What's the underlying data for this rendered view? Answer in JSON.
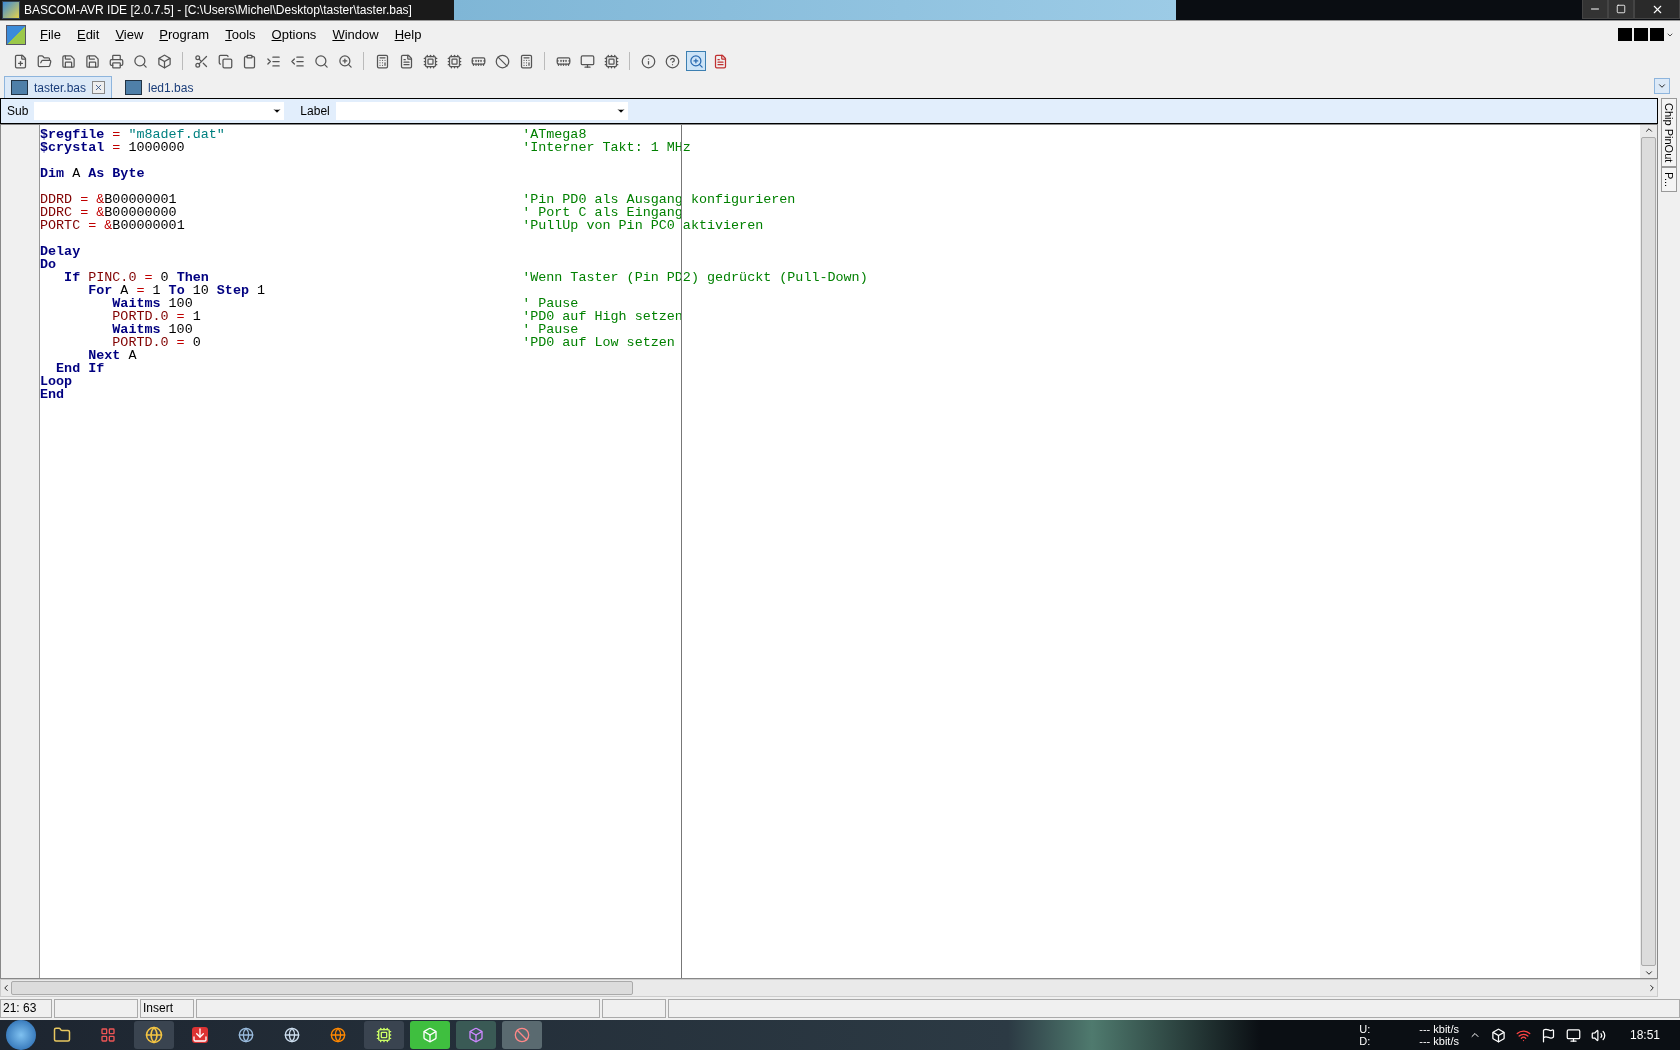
{
  "window": {
    "title": "BASCOM-AVR IDE [2.0.7.5] - [C:\\Users\\Michel\\Desktop\\taster\\taster.bas]"
  },
  "menu": [
    "File",
    "Edit",
    "View",
    "Program",
    "Tools",
    "Options",
    "Window",
    "Help"
  ],
  "tabs": [
    {
      "label": "taster.bas",
      "selected": true
    },
    {
      "label": "led1.bas",
      "selected": false
    }
  ],
  "navigator": {
    "sub_label": "Sub",
    "label_label": "Label"
  },
  "side_tabs": [
    "Chip PinOut",
    "P..."
  ],
  "editor": {
    "lines": [
      {
        "kind": "code",
        "code": [
          {
            "kind": "kw",
            "text": "$regfile"
          },
          {
            "kind": "op",
            "text": " = "
          },
          {
            "kind": "str",
            "text": "\"m8adef.dat\""
          }
        ],
        "comment": "'ATmega8"
      },
      {
        "kind": "code",
        "code": [
          {
            "kind": "kw",
            "text": "$crystal"
          },
          {
            "kind": "op",
            "text": " = "
          },
          {
            "kind": "num",
            "text": "1000000"
          }
        ],
        "comment": "'Interner Takt: 1 MHz"
      },
      {
        "kind": "blank"
      },
      {
        "kind": "code",
        "code": [
          {
            "kind": "kw",
            "text": "Dim"
          },
          {
            "kind": "plain",
            "text": " A "
          },
          {
            "kind": "kw",
            "text": "As Byte"
          }
        ]
      },
      {
        "kind": "blank"
      },
      {
        "kind": "code",
        "code": [
          {
            "kind": "reg",
            "text": "DDRD"
          },
          {
            "kind": "op",
            "text": " = &"
          },
          {
            "kind": "num",
            "text": "B00000001"
          }
        ],
        "comment": "'Pin PD0 als Ausgang konfigurieren"
      },
      {
        "kind": "code",
        "code": [
          {
            "kind": "reg",
            "text": "DDRC"
          },
          {
            "kind": "op",
            "text": " = &"
          },
          {
            "kind": "num",
            "text": "B00000000"
          }
        ],
        "comment": "' Port C als Eingang"
      },
      {
        "kind": "code",
        "code": [
          {
            "kind": "reg",
            "text": "PORTC"
          },
          {
            "kind": "op",
            "text": " = &"
          },
          {
            "kind": "num",
            "text": "B00000001"
          }
        ],
        "comment": "'PullUp von Pin PC0 aktivieren"
      },
      {
        "kind": "blank"
      },
      {
        "kind": "code",
        "code": [
          {
            "kind": "kw",
            "text": "Delay"
          }
        ]
      },
      {
        "kind": "code",
        "code": [
          {
            "kind": "kw",
            "text": "Do"
          }
        ]
      },
      {
        "kind": "code",
        "code": [
          {
            "kind": "kw",
            "text": "   If "
          },
          {
            "kind": "reg",
            "text": "PINC.0"
          },
          {
            "kind": "op",
            "text": " = "
          },
          {
            "kind": "num",
            "text": "0 "
          },
          {
            "kind": "kw",
            "text": "Then"
          }
        ],
        "comment": "'Wenn Taster (Pin PD2) gedrückt (Pull-Down)"
      },
      {
        "kind": "code",
        "code": [
          {
            "kind": "kw",
            "text": "      For "
          },
          {
            "kind": "plain",
            "text": "A"
          },
          {
            "kind": "op",
            "text": " = "
          },
          {
            "kind": "num",
            "text": "1 "
          },
          {
            "kind": "kw",
            "text": "To "
          },
          {
            "kind": "num",
            "text": "10 "
          },
          {
            "kind": "kw",
            "text": "Step "
          },
          {
            "kind": "num",
            "text": "1"
          }
        ]
      },
      {
        "kind": "code",
        "code": [
          {
            "kind": "kw",
            "text": "         Waitms "
          },
          {
            "kind": "num",
            "text": "100"
          }
        ],
        "comment": "' Pause"
      },
      {
        "kind": "code",
        "code": [
          {
            "kind": "reg",
            "text": "         PORTD.0"
          },
          {
            "kind": "op",
            "text": " = "
          },
          {
            "kind": "num",
            "text": "1"
          }
        ],
        "comment": "'PD0 auf High setzen"
      },
      {
        "kind": "code",
        "code": [
          {
            "kind": "kw",
            "text": "         Waitms "
          },
          {
            "kind": "num",
            "text": "100"
          }
        ],
        "comment": "' Pause"
      },
      {
        "kind": "code",
        "code": [
          {
            "kind": "reg",
            "text": "         PORTD.0"
          },
          {
            "kind": "op",
            "text": " = "
          },
          {
            "kind": "num",
            "text": "0"
          }
        ],
        "comment": "'PD0 auf Low setzen"
      },
      {
        "kind": "code",
        "code": [
          {
            "kind": "kw",
            "text": "      Next "
          },
          {
            "kind": "plain",
            "text": "A"
          }
        ]
      },
      {
        "kind": "code",
        "code": [
          {
            "kind": "kw",
            "text": "  End If"
          }
        ]
      },
      {
        "kind": "code",
        "code": [
          {
            "kind": "kw",
            "text": "Loop"
          }
        ]
      },
      {
        "kind": "code",
        "code": [
          {
            "kind": "kw",
            "text": "End"
          }
        ]
      }
    ]
  },
  "status_bar": {
    "position": "21: 63",
    "mode": "Insert"
  },
  "taskbar": {
    "upload_label": "U:",
    "upload_rate": "--- kbit/s",
    "download_label": "D:",
    "download_rate": "--- kbit/s",
    "clock": "18:51"
  }
}
